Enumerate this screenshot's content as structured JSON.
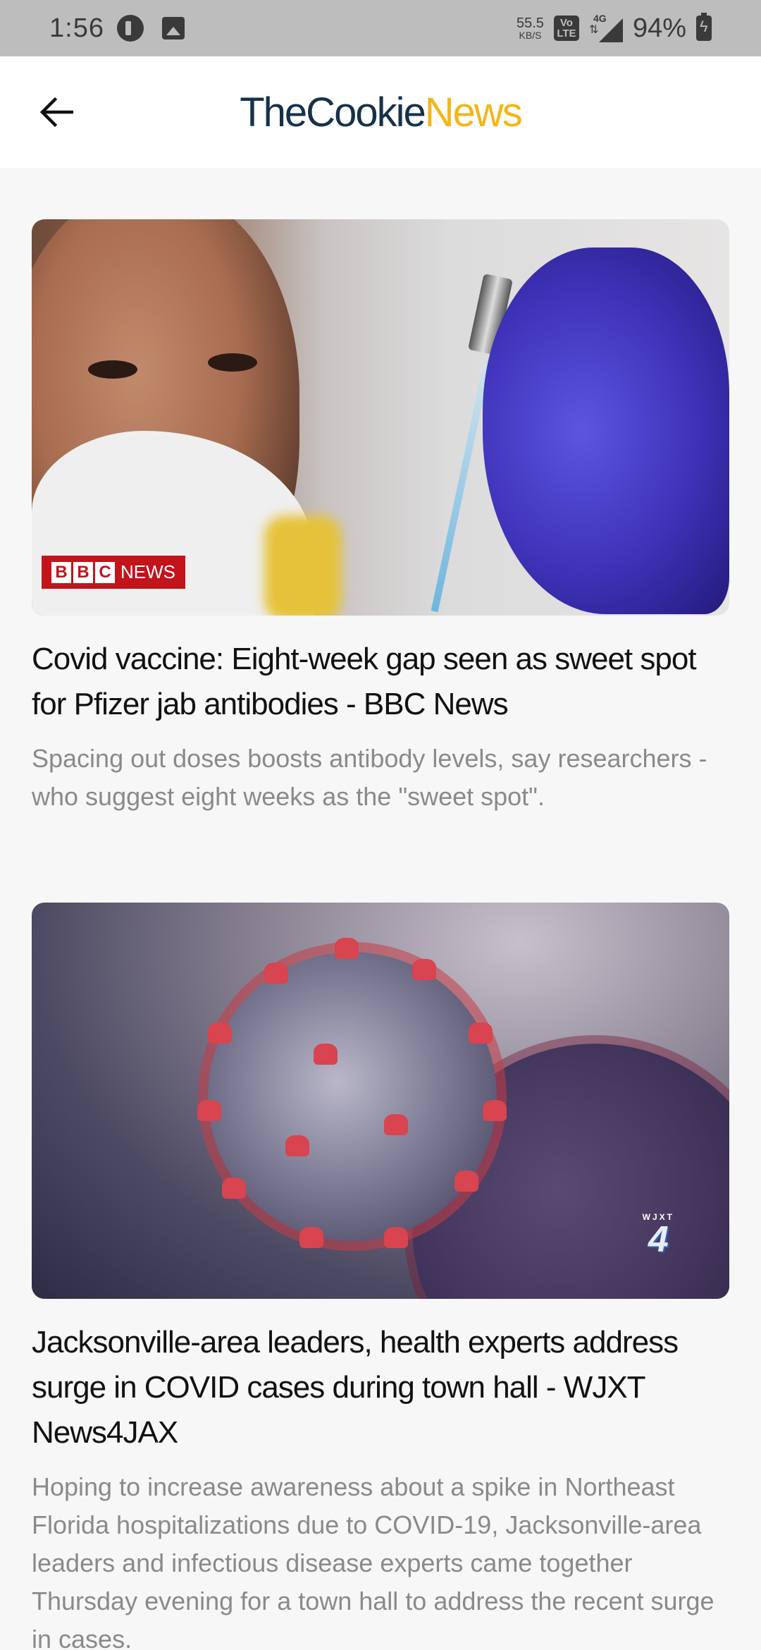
{
  "status_bar": {
    "time": "1:56",
    "net_speed": "55.5",
    "net_speed_unit": "KB/S",
    "volte_top": "Vo",
    "volte_bottom": "LTE",
    "network": "4G",
    "battery": "94%"
  },
  "header": {
    "logo_part1": "TheCookie",
    "logo_part2": "News",
    "back_icon": "arrow-left-icon",
    "colors": {
      "logo_dark": "#16324a",
      "logo_accent": "#f2b61d"
    }
  },
  "articles": [
    {
      "image_badge": "NEWS",
      "badge_letters": [
        "B",
        "B",
        "C"
      ],
      "title": "Covid vaccine: Eight-week gap seen as sweet spot for Pfizer jab antibodies - BBC News",
      "description": "Spacing out doses boosts antibody levels, say researchers - who suggest eight weeks as the \"sweet spot\"."
    },
    {
      "image_badge_call": "WJXT",
      "image_badge_num": "4",
      "title": "Jacksonville-area leaders, health experts address surge in COVID cases during town hall - WJXT News4JAX",
      "description": "Hoping to increase awareness about a spike in Northeast Florida hospitalizations due to COVID-19, Jacksonville-area leaders and infectious disease experts came together Thursday evening for a town hall to address the recent surge in cases."
    }
  ]
}
